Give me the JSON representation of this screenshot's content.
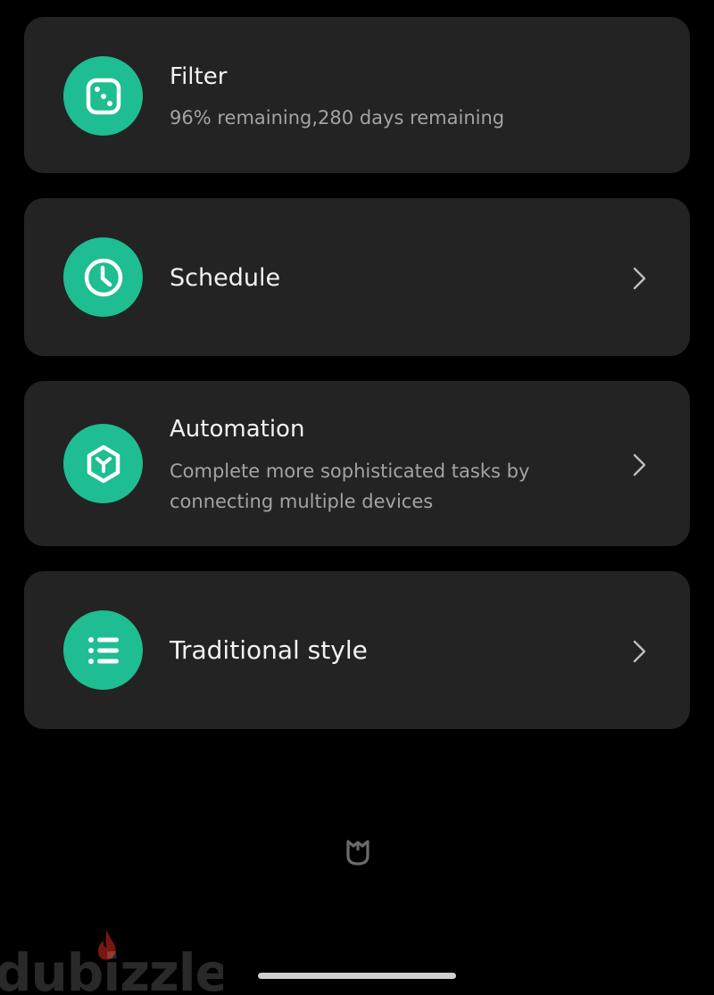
{
  "colors": {
    "accent": "#1ebd92",
    "card_background": "#232323",
    "page_background": "#000000"
  },
  "cards": [
    {
      "title": "Filter",
      "subtitle": "96% remaining,280 days remaining",
      "icon": "filter-icon",
      "has_chevron": false
    },
    {
      "title": "Schedule",
      "subtitle": "",
      "icon": "clock-icon",
      "has_chevron": true
    },
    {
      "title": "Automation",
      "subtitle": "Complete more sophisticated tasks by connecting multiple devices",
      "icon": "automation-icon",
      "has_chevron": true
    },
    {
      "title": "Traditional style",
      "subtitle": "",
      "icon": "list-icon",
      "has_chevron": true
    }
  ],
  "footer": {
    "brand_icon": "mi-home-logo-icon",
    "watermark": "dubizzle"
  }
}
